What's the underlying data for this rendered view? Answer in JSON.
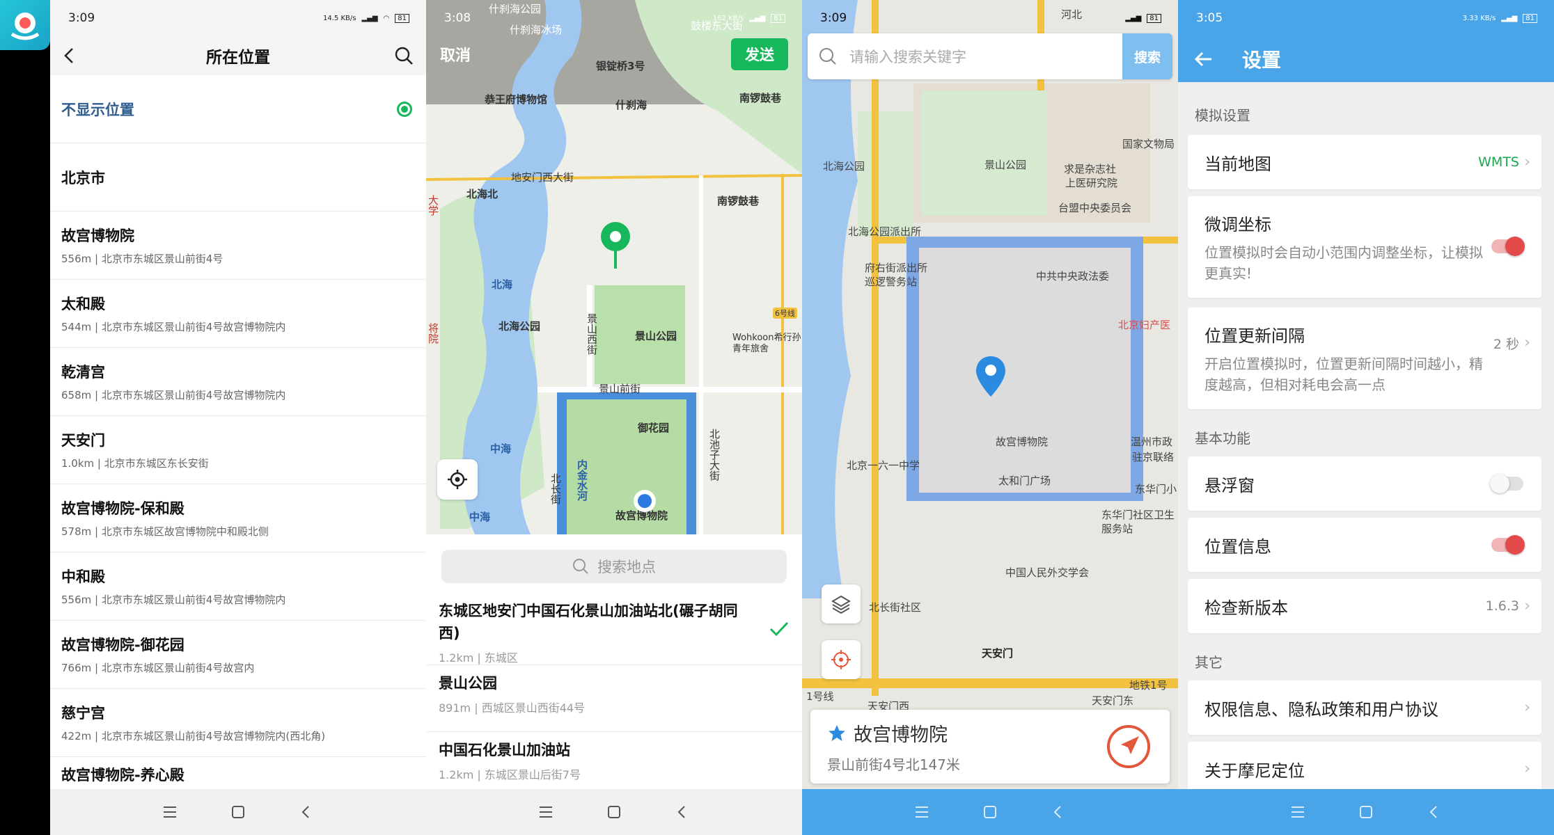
{
  "screen1": {
    "time": "3:09",
    "status_net": "14.5 KB/s",
    "battery": "81",
    "title": "所在位置",
    "items": [
      {
        "name": "不显示位置",
        "sub": ""
      },
      {
        "name": "北京市",
        "sub": ""
      },
      {
        "name": "故宫博物院",
        "sub": "556m | 北京市东城区景山前街4号"
      },
      {
        "name": "太和殿",
        "sub": "544m | 北京市东城区景山前街4号故宫博物院内"
      },
      {
        "name": "乾清宫",
        "sub": "658m | 北京市东城区景山前街4号故宫博物院内"
      },
      {
        "name": "天安门",
        "sub": "1.0km | 北京市东城区东长安街"
      },
      {
        "name": "故宫博物院-保和殿",
        "sub": "578m | 北京市东城区故宫博物院中和殿北侧"
      },
      {
        "name": "中和殿",
        "sub": "556m | 北京市东城区景山前街4号故宫博物院内"
      },
      {
        "name": "故宫博物院-御花园",
        "sub": "766m | 北京市东城区景山前街4号故宫内"
      },
      {
        "name": "慈宁宫",
        "sub": "422m | 北京市东城区景山前街4号故宫博物院内(西北角)"
      },
      {
        "name": "故宫博物院-养心殿",
        "sub": ""
      }
    ]
  },
  "screen2": {
    "time": "3:08",
    "status_net": "162 KB/s",
    "battery": "81",
    "cancel": "取消",
    "send": "发送",
    "map_labels": {
      "shichahai_museum": "什刹海公园",
      "ice_rink": "什刹海冰场",
      "drum_tower": "鼓楼东大街",
      "yindingqiao": "银锭桥3号",
      "gongwangfu": "恭王府博物馆",
      "shichahai": "什刹海",
      "nanluoguxiang": "南锣鼓巷",
      "dianmen": "地安门西大街",
      "beihaibei": "北海北",
      "nanluoguxiang2": "南锣鼓巷",
      "beihai": "北海",
      "beihai_park": "北海公园",
      "jingshan_west": "景山西街",
      "jingshan_park": "景山公园",
      "wohkoon": "Wohkoon希行孙青年旅舍",
      "jingshan_front": "景山前街",
      "yuhuayuan": "御花园",
      "zhonghai": "中海",
      "nei_jinshui": "内金水河",
      "beichang": "北长街",
      "beichizi": "北池子大街",
      "forbidden": "故宫博物院",
      "zhonghai2": "中海",
      "line6": "6号线",
      "university": "大学",
      "chaoyang": "将院"
    },
    "search_placeholder": "搜索地点",
    "pois": [
      {
        "name": "东城区地安门中国石化景山加油站北(碾子胡同西)",
        "sub": "1.2km | 东城区"
      },
      {
        "name": "景山公园",
        "sub": "891m | 西城区景山西街44号"
      },
      {
        "name": "中国石化景山加油站",
        "sub": "1.2km | 东城区景山后街7号"
      }
    ]
  },
  "screen3": {
    "time": "3:09",
    "battery": "81",
    "search_placeholder": "请输入搜索关键字",
    "search_button": "搜索",
    "map_labels": {
      "beihai_park": "北海公园",
      "jingshan_park": "景山公园",
      "guojia_wenwu": "国家文物局",
      "qiushi": "求是杂志社",
      "shangyi": "上医研究院",
      "taimeng": "台盟中央委员会",
      "beihai_police": "北海公园派出所",
      "fuyou": "府右街派出所",
      "xunluo": "巡逻警务站",
      "zhonggong": "中共中央政法委",
      "fuchan": "北京妇产医",
      "gugong": "故宫博物院",
      "wenzhou": "温州市政",
      "zhujing": "驻京联络",
      "beijing161": "北京一六一中学",
      "taihemen": "太和门广场",
      "donghuamen": "东华门小",
      "donghuamen_ws": "东华门社区卫生服务站",
      "beichangjie": "北长街社区",
      "waijiao": "中国人民外交学会",
      "tiananmen": "天安门",
      "metro1": "地铁1号",
      "line1": "1号线",
      "tiananmen_east": "天安门东",
      "tiananmen_west": "天安门西",
      "hebei": "河北"
    },
    "card_name": "故宫博物院",
    "card_addr": "景山前街4号北147米"
  },
  "screen4": {
    "time": "3:05",
    "status_net": "3.33 KB/s",
    "battery": "81",
    "title": "设置",
    "sections": {
      "sim": "模拟设置",
      "basic": "基本功能",
      "other": "其它"
    },
    "current_map": {
      "label": "当前地图",
      "value": "WMTS"
    },
    "fine_tune": {
      "label": "微调坐标",
      "desc": "位置模拟时会自动小范围内调整坐标，让模拟更真实!",
      "on": true
    },
    "interval": {
      "label": "位置更新间隔",
      "value": "2 秒",
      "desc": "开启位置模拟时，位置更新间隔时间越小，精度越高，但相对耗电会高一点"
    },
    "floating": {
      "label": "悬浮窗",
      "on": false
    },
    "location_info": {
      "label": "位置信息",
      "on": true
    },
    "check_update": {
      "label": "检查新版本",
      "value": "1.6.3"
    },
    "privacy": {
      "label": "权限信息、隐私政策和用户协议"
    },
    "about": {
      "label": "关于摩尼定位"
    }
  },
  "colors": {
    "green": "#17b85c",
    "blue": "#4aa5e8",
    "red": "#e34a4a"
  }
}
